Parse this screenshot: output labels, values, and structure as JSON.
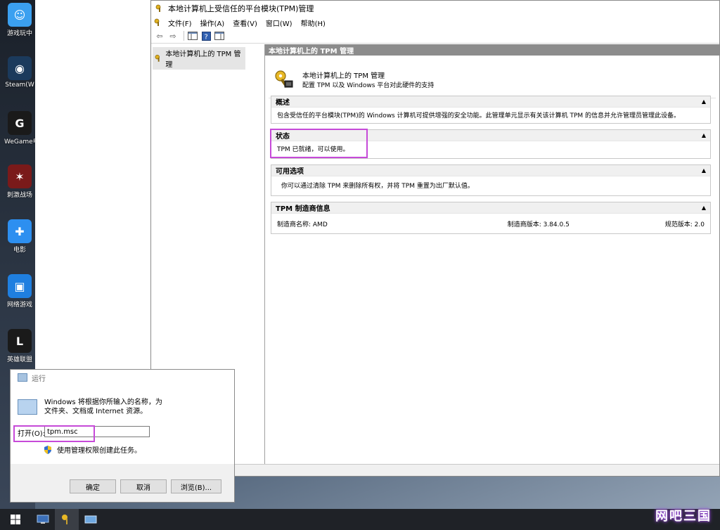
{
  "desktop": {
    "icons": [
      {
        "label": "游戏玩中",
        "color": "#3ba0f0",
        "glyph": "☺"
      },
      {
        "label": "Steam(W",
        "color": "#1b3a5c",
        "glyph": "◉"
      },
      {
        "label": "WeGame电脑",
        "color": "#1a1a1a",
        "glyph": "G"
      },
      {
        "label": "刺激战场",
        "color": "#7a1a1a",
        "glyph": "✶"
      },
      {
        "label": "电影",
        "color": "#2d8ff0",
        "glyph": "✚"
      },
      {
        "label": "网络游戏",
        "color": "#1f7fe0",
        "glyph": "▣"
      },
      {
        "label": "英雄联盟",
        "color": "#1a1a1a",
        "glyph": "L"
      }
    ]
  },
  "tpm_window": {
    "title": "本地计算机上受信任的平台模块(TPM)管理",
    "menu": [
      "文件(F)",
      "操作(A)",
      "查看(V)",
      "窗口(W)",
      "帮助(H)"
    ],
    "tree_item": "本地计算机上的 TPM 管理",
    "content_header": "本地计算机上的 TPM 管理",
    "hero_line1": "本地计算机上的 TPM 管理",
    "hero_line2": "配置 TPM 以及 Windows 平台对此硬件的支持",
    "sections": {
      "overview": {
        "title": "概述",
        "body": "包含受信任的平台模块(TPM)的 Windows 计算机可提供增强的安全功能。此管理单元显示有关该计算机 TPM 的信息并允许管理员管理此设备。"
      },
      "status": {
        "title": "状态",
        "body": "TPM 已就绪，可以使用。"
      },
      "options": {
        "title": "可用选项",
        "body": "你可以通过清除 TPM 来删除所有权，并将 TPM 重置为出厂默认值。"
      },
      "manufacturer": {
        "title": "TPM 制造商信息",
        "name": "制造商名称: AMD",
        "version": "制造商版本: 3.84.0.5",
        "spec": "规范版本: 2.0"
      }
    },
    "collapse_glyph": "▲"
  },
  "run_dialog": {
    "title": "运行",
    "description_l1": "Windows 将根据你所输入的名称，为",
    "description_l2": "文件夹、文档或 Internet 资源。",
    "open_label": "打开(O):",
    "open_value": "tpm.msc",
    "admin_text": "使用管理权限创建此任务。",
    "ok": "确定",
    "cancel": "取消",
    "browse": "浏览(B)..."
  },
  "watermark": "网吧三国",
  "colors": {
    "highlight": "#c64ad8",
    "section_header_bg": "#f0f0f0",
    "content_header_bg": "#8c8c8c"
  }
}
